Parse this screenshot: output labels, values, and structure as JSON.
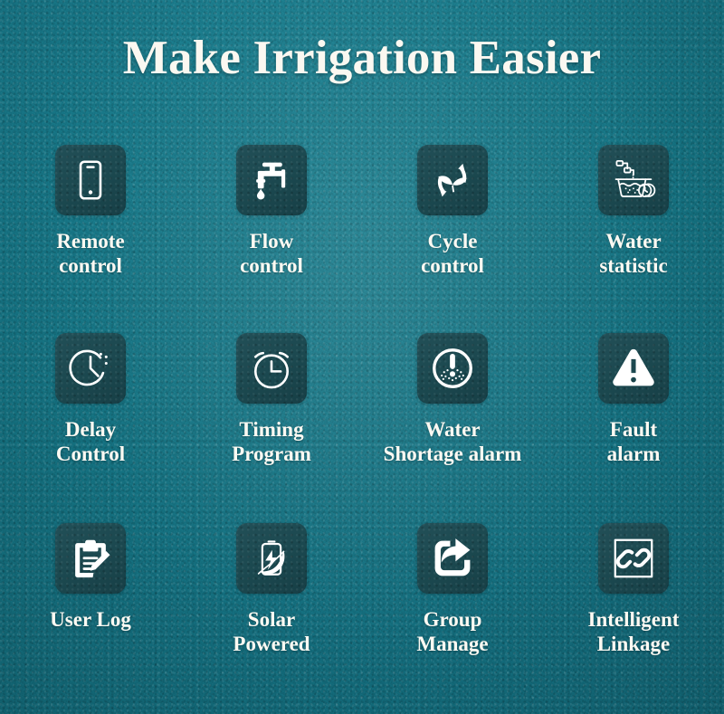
{
  "poster": {
    "title": "Make Irrigation Easier",
    "background_color": "#157384",
    "tile_color": "#1d4c53",
    "text_color": "#fdfaf3"
  },
  "features": [
    {
      "id": "remote-control",
      "icon": "smartphone-icon",
      "label_line1": "Remote",
      "label_line2": "control"
    },
    {
      "id": "flow-control",
      "icon": "faucet-icon",
      "label_line1": "Flow",
      "label_line2": "control"
    },
    {
      "id": "cycle-control",
      "icon": "recycle-leaf-icon",
      "label_line1": "Cycle",
      "label_line2": "control"
    },
    {
      "id": "water-statistic",
      "icon": "water-basin-clock-icon",
      "label_line1": "Water",
      "label_line2": "statistic"
    },
    {
      "id": "delay-control",
      "icon": "clock-dashed-icon",
      "label_line1": "Delay",
      "label_line2": "Control"
    },
    {
      "id": "timing-program",
      "icon": "alarm-clock-icon",
      "label_line1": "Timing",
      "label_line2": "Program"
    },
    {
      "id": "water-shortage-alarm",
      "icon": "exclamation-circle-dots-icon",
      "label_line1": "Water",
      "label_line2": "Shortage alarm"
    },
    {
      "id": "fault-alarm",
      "icon": "warning-triangle-icon",
      "label_line1": "Fault",
      "label_line2": "alarm"
    },
    {
      "id": "user-log",
      "icon": "clipboard-pencil-icon",
      "label_line1": "User Log",
      "label_line2": ""
    },
    {
      "id": "solar-powered",
      "icon": "battery-leaf-icon",
      "label_line1": "Solar",
      "label_line2": "Powered"
    },
    {
      "id": "group-manage",
      "icon": "share-arrow-icon",
      "label_line1": "Group",
      "label_line2": "Manage"
    },
    {
      "id": "intelligent-linkage",
      "icon": "chain-link-square-icon",
      "label_line1": "Intelligent",
      "label_line2": "Linkage"
    }
  ]
}
